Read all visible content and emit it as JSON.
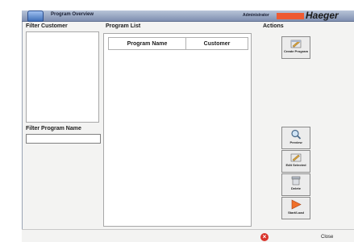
{
  "window": {
    "title": "Program Overview",
    "user": "Administrator",
    "logo_text": "Haeger",
    "logo_color": "#ee5a32"
  },
  "filters": {
    "customer_label": "Filter Customer",
    "program_name_label": "Filter Program Name",
    "program_name_value": ""
  },
  "program_list": {
    "label": "Program List",
    "columns": [
      "Program Name",
      "Customer"
    ],
    "rows": []
  },
  "actions": {
    "label": "Actions",
    "create": "Create Program",
    "preview": "Preview",
    "edit": "Edit Selected",
    "delete": "Delete",
    "start": "Start/Load"
  },
  "footer": {
    "close_label": "Close"
  }
}
